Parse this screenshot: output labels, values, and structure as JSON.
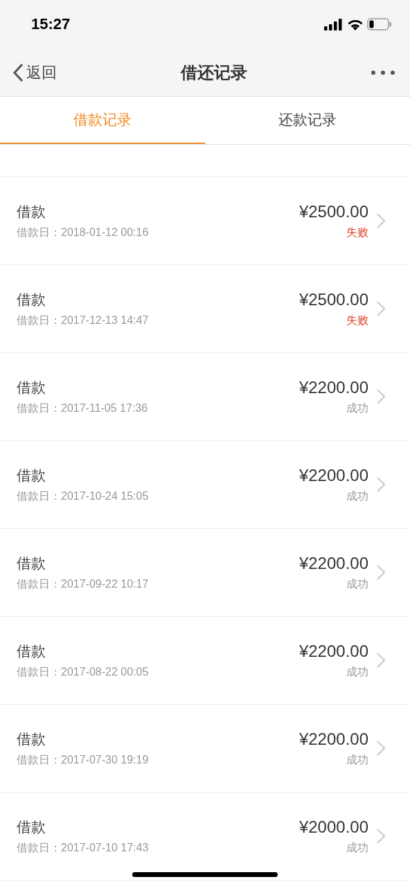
{
  "status_bar": {
    "time": "15:27"
  },
  "nav": {
    "back": "返回",
    "title": "借还记录"
  },
  "tabs": [
    {
      "label": "借款记录",
      "selected": true
    },
    {
      "label": "还款记录",
      "selected": false
    }
  ],
  "records": [
    {
      "type": "借款",
      "date": "借款日：2018-01-12 00:16",
      "amount": "¥2500.00",
      "status": "失败",
      "failed": true
    },
    {
      "type": "借款",
      "date": "借款日：2017-12-13 14:47",
      "amount": "¥2500.00",
      "status": "失败",
      "failed": true
    },
    {
      "type": "借款",
      "date": "借款日：2017-11-05 17:36",
      "amount": "¥2200.00",
      "status": "成功",
      "failed": false
    },
    {
      "type": "借款",
      "date": "借款日：2017-10-24 15:05",
      "amount": "¥2200.00",
      "status": "成功",
      "failed": false
    },
    {
      "type": "借款",
      "date": "借款日：2017-09-22 10:17",
      "amount": "¥2200.00",
      "status": "成功",
      "failed": false
    },
    {
      "type": "借款",
      "date": "借款日：2017-08-22 00:05",
      "amount": "¥2200.00",
      "status": "成功",
      "failed": false
    },
    {
      "type": "借款",
      "date": "借款日：2017-07-30 19:19",
      "amount": "¥2200.00",
      "status": "成功",
      "failed": false
    },
    {
      "type": "借款",
      "date": "借款日：2017-07-10 17:43",
      "amount": "¥2000.00",
      "status": "成功",
      "failed": false
    }
  ]
}
